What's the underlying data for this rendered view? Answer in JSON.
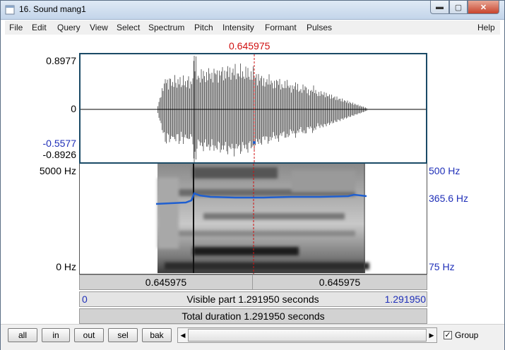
{
  "window": {
    "title": "16. Sound mang1",
    "min": "▬",
    "max": "▢",
    "close": "✕"
  },
  "menu": [
    "File",
    "Edit",
    "Query",
    "View",
    "Select",
    "Spectrum",
    "Pitch",
    "Intensity",
    "Formant",
    "Pulses"
  ],
  "help": "Help",
  "cursor_time": "0.645975",
  "waveform": {
    "y_top": "0.8977",
    "y_zero": "0",
    "y_cursor": "-0.5577",
    "y_bottom": "-0.8926"
  },
  "spectrogram": {
    "freq_top": "5000 Hz",
    "freq_bottom": "0 Hz",
    "pitch_top": "500 Hz",
    "pitch_value": "365.6 Hz",
    "pitch_bottom": "75 Hz"
  },
  "selection_bar": {
    "left": "0.645975",
    "right": "0.645975"
  },
  "visible_bar": {
    "start": "0",
    "label": "Visible part 1.291950 seconds",
    "end": "1.291950"
  },
  "total_bar": {
    "label": "Total duration 1.291950 seconds"
  },
  "buttons": {
    "all": "all",
    "in": "in",
    "out": "out",
    "sel": "sel",
    "bak": "bak"
  },
  "scroll": {
    "left_arrow": "◀",
    "right_arrow": "▶"
  },
  "group": {
    "label": "Group",
    "checked": "✓"
  },
  "colors": {
    "cursor": "#d01010",
    "pitch": "#1f5fd0",
    "blue_text": "#1f2fb8"
  }
}
